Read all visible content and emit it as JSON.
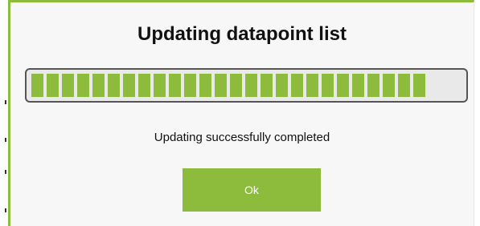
{
  "dialog": {
    "title": "Updating datapoint list",
    "status_text": "Updating successfully completed",
    "ok_label": "Ok",
    "accent_color": "#8dbb3c"
  },
  "progress": {
    "fraction": 1.0,
    "segment_count": 26
  }
}
